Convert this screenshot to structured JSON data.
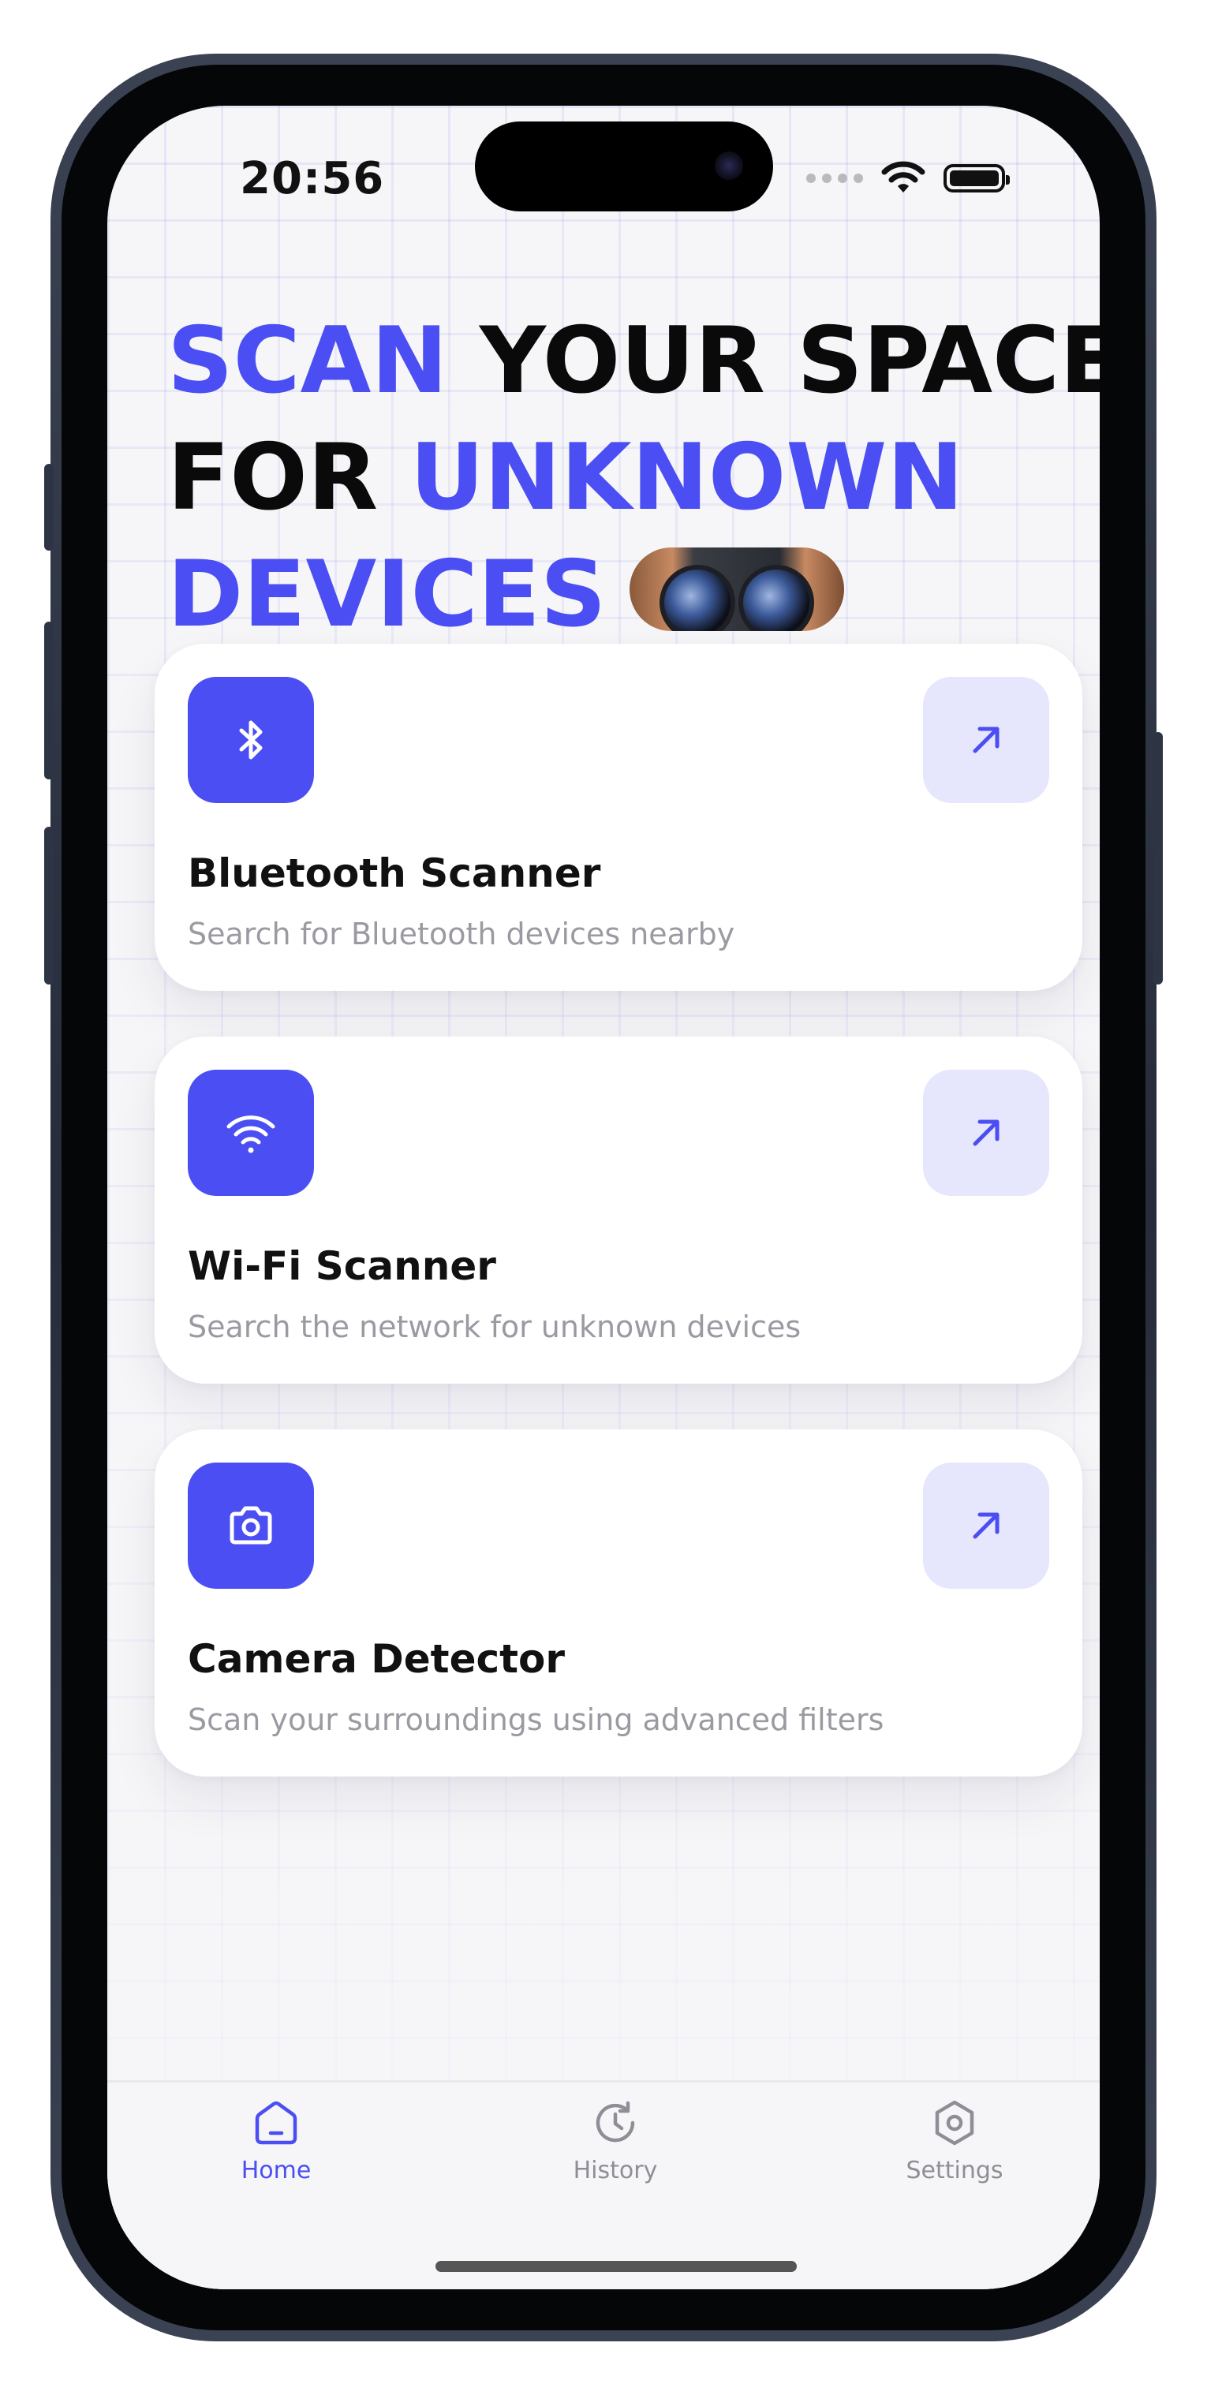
{
  "status_bar": {
    "time": "20:56",
    "wifi_icon": "wifi-icon",
    "battery_icon": "battery-icon"
  },
  "headline": {
    "line1_accent": "SCAN",
    "line1_rest": " YOUR SPACE",
    "line2_start": "FOR ",
    "line2_accent": "UNKNOWN",
    "line3_accent": "DEVICES",
    "emoji": "binoculars-image"
  },
  "cards": [
    {
      "title": "Bluetooth Scanner",
      "subtitle": "Search for Bluetooth devices nearby",
      "icon": "bluetooth-icon"
    },
    {
      "title": "Wi-Fi Scanner",
      "subtitle": "Search the network for unknown devices",
      "icon": "wifi-icon"
    },
    {
      "title": "Camera Detector",
      "subtitle": "Scan your surroundings using advanced filters",
      "icon": "camera-icon"
    }
  ],
  "tabbar": {
    "tabs": [
      {
        "label": "Home",
        "icon": "home-icon",
        "active": true
      },
      {
        "label": "History",
        "icon": "history-icon",
        "active": false
      },
      {
        "label": "Settings",
        "icon": "settings-icon",
        "active": false
      }
    ]
  },
  "colors": {
    "accent": "#4b4ef2",
    "accent_light": "#e6e6fc",
    "text_primary": "#111111",
    "text_secondary": "#9a9aa2",
    "inactive_tab": "#8e8e96"
  }
}
